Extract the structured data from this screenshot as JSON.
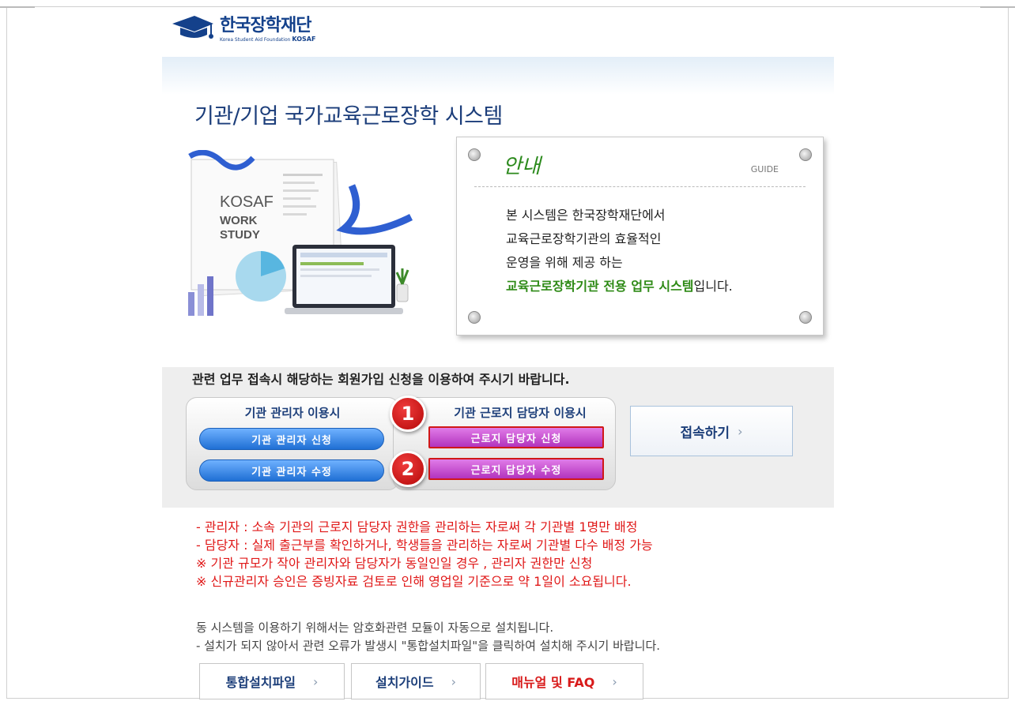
{
  "logo": {
    "name": "한국장학재단",
    "sub_text": "Korea Student Aid Foundation",
    "sub_brand": "KOSAF"
  },
  "page_title": "기관/기업 국가교육근로장학 시스템",
  "illustration": {
    "book_lines": [
      "KOSAF",
      "WORK",
      "STUDY"
    ]
  },
  "guide": {
    "title": "안내",
    "title_en": "GUIDE",
    "lines": [
      "본 시스템은 한국장학재단에서",
      "교육근로장학기관의 효율적인",
      "운영을 위해 제공 하는"
    ],
    "highlight": "교육근로장학기관 전용 업무 시스템",
    "suffix": "입니다."
  },
  "login": {
    "instruction": "관련 업무 접속시 해당하는 회원가입 신청을 이용하여 주시기 바랍니다.",
    "admin_group": {
      "title": "기관 관리자 이용시",
      "apply_label": "기관 관리자 신청",
      "modify_label": "기관 관리자 수정"
    },
    "staff_group": {
      "title": "기관 근로지 담당자 이용시",
      "apply_label": "근로지 담당자 신청",
      "modify_label": "근로지 담당자 수정"
    },
    "badges": [
      "1",
      "2"
    ],
    "connect_label": "접속하기",
    "connect_chevron": "›"
  },
  "notes": [
    "- 관리자 : 소속 기관의 근로지 담당자 권한을 관리하는 자로써 각 기관별 1명만 배정",
    "- 담당자 : 실제 출근부를 확인하거나, 학생들을 관리하는 자로써 기관별 다수 배정 가능",
    "※ 기관 규모가 작아 관리자와 담당자가 동일인일 경우 , 관리자 권한만 신청",
    "※ 신규관리자 승인은 증빙자료 검토로 인해 영업일 기준으로 약 1일이 소요됩니다."
  ],
  "install_info": [
    "동 시스템을 이용하기 위해서는 암호화관련 모듈이 자동으로 설치됩니다.",
    "- 설치가 되지 않아서 관련 오류가 발생시 \"통합설치파일\"을 클릭하여 설치해 주시기 바랍니다."
  ],
  "bottom_buttons": [
    {
      "label": "통합설치파일",
      "chevron": "›"
    },
    {
      "label": "설치가이드",
      "chevron": "›"
    },
    {
      "label": "매뉴얼 및 FAQ",
      "chevron": "›"
    }
  ],
  "colors": {
    "brand": "#14418b",
    "guide_green": "#2e8a16",
    "note_red": "#e01818",
    "admin_blue": "#1f6fd4",
    "staff_purple": "#b233bd"
  }
}
